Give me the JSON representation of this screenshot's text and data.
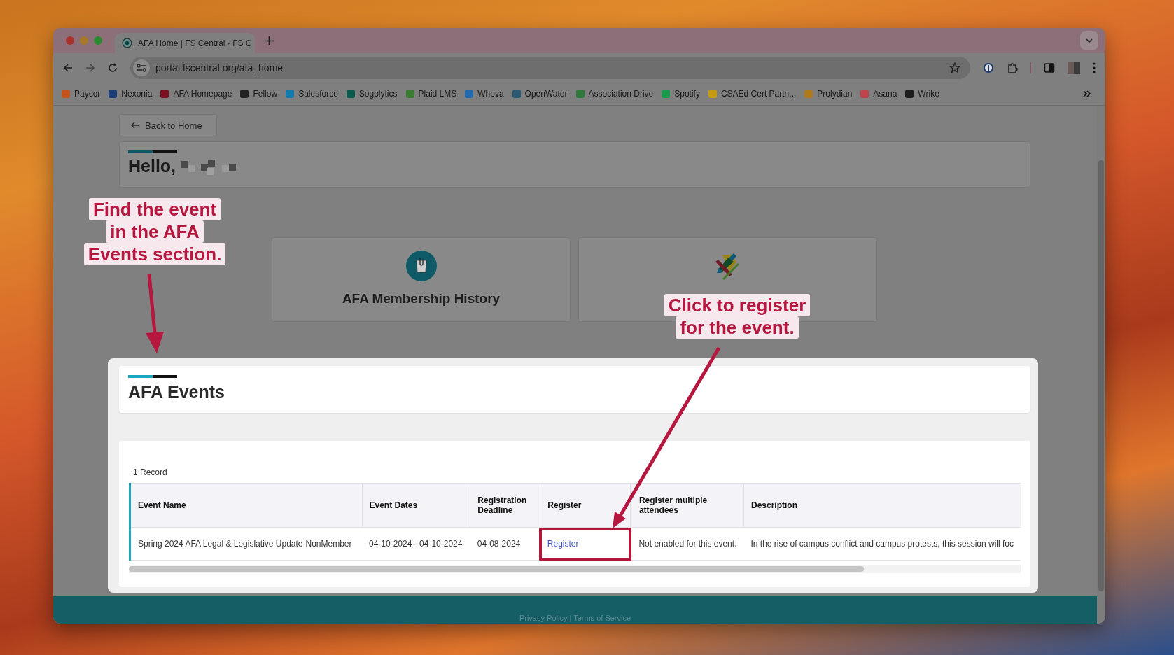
{
  "browser": {
    "tab_title": "AFA Home | FS Central · FS C",
    "url": "portal.fscentral.org/afa_home",
    "bookmarks": [
      {
        "label": "Paycor",
        "color": "#c2531c"
      },
      {
        "label": "Nexonia",
        "color": "#1d3f7a"
      },
      {
        "label": "AFA Homepage",
        "color": "#7a1020"
      },
      {
        "label": "Fellow",
        "color": "#222222"
      },
      {
        "label": "Salesforce",
        "color": "#1479ad"
      },
      {
        "label": "Sogolytics",
        "color": "#0b5a4e"
      },
      {
        "label": "Plaid LMS",
        "color": "#3b7a32"
      },
      {
        "label": "Whova",
        "color": "#2369ad"
      },
      {
        "label": "OpenWater",
        "color": "#2a5a72"
      },
      {
        "label": "Association Drive",
        "color": "#2f7a3a"
      },
      {
        "label": "Spotify",
        "color": "#199a4a"
      },
      {
        "label": "CSAEd Cert Partn...",
        "color": "#c49a12"
      },
      {
        "label": "Prolydian",
        "color": "#b07a1c"
      },
      {
        "label": "Asana",
        "color": "#c0444c"
      },
      {
        "label": "Wrike",
        "color": "#1e1e1e"
      }
    ]
  },
  "page": {
    "back_button": "Back to Home",
    "greeting": "Hello,",
    "cards": [
      {
        "kind": "membership",
        "title": "AFA Membership History"
      },
      {
        "kind": "pencils"
      }
    ],
    "events": {
      "title": "AFA Events",
      "record_count": "1 Record",
      "columns": [
        "Event Name",
        "Event Dates",
        "Registration Deadline",
        "Register",
        "Register multiple attendees",
        "Description"
      ],
      "rows": [
        {
          "event_name": "Spring 2024 AFA Legal & Legislative Update-NonMember",
          "event_dates": "04-10-2024 - 04-10-2024",
          "deadline": "04-08-2024",
          "register": "Register",
          "register_highlighted": true,
          "multiple": "Not enabled for this event.",
          "description": "In the rise of campus conflict and campus protests, this session will foc"
        }
      ]
    },
    "footer": "Privacy Policy | Terms of Service"
  },
  "annotations": [
    {
      "kind": "left",
      "lines": [
        "Find the event",
        "in the AFA",
        "Events section."
      ]
    },
    {
      "kind": "right",
      "lines": [
        "Click to register",
        "for the event."
      ]
    }
  ]
}
